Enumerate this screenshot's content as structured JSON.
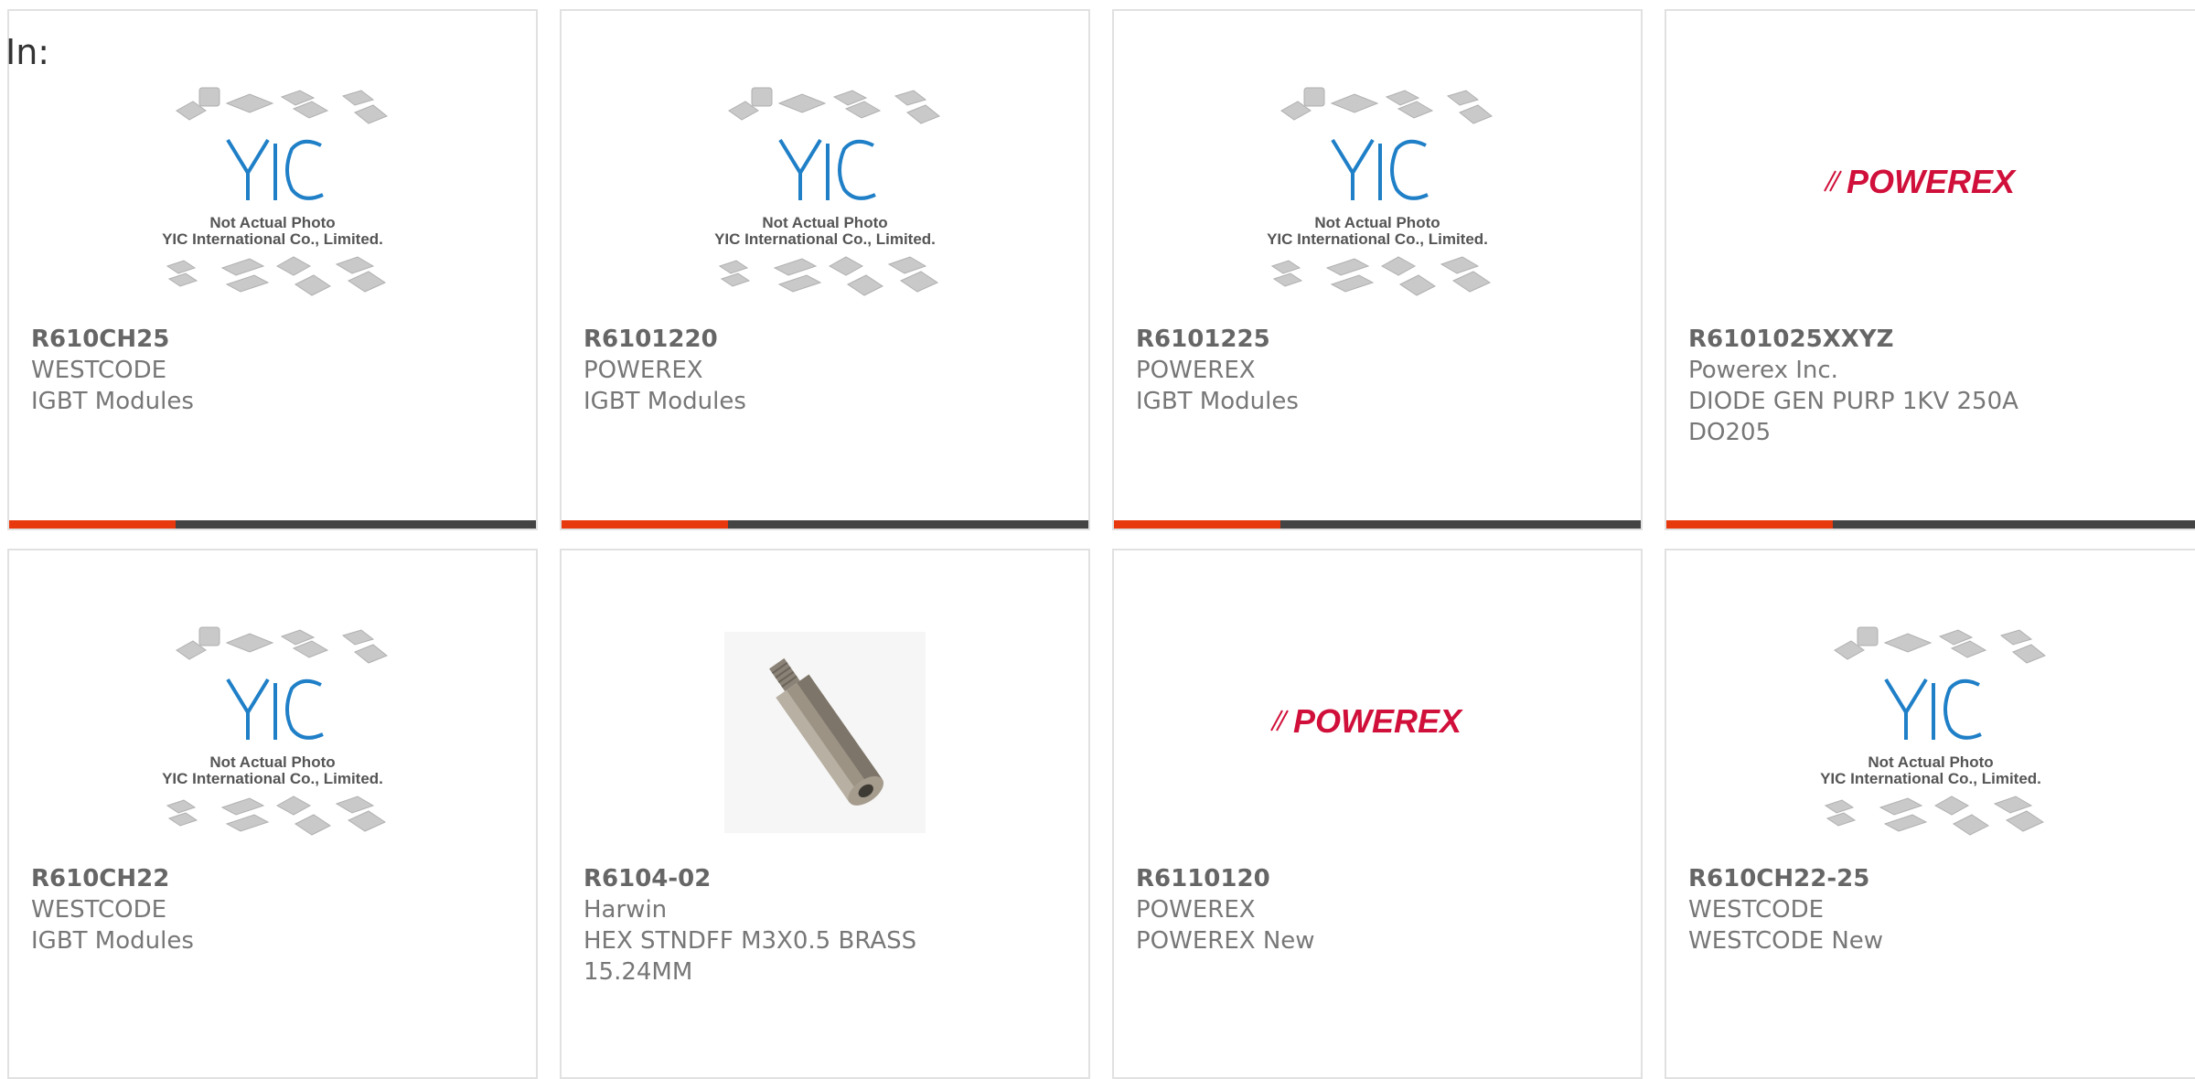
{
  "page": {
    "prefix_label": "In:"
  },
  "colors": {
    "accent": "#e8380d",
    "bar": "#444444",
    "yic_blue": "#1f7fc7",
    "powerex_red": "#d0103a"
  },
  "placeholder_text": {
    "line1": "Not Actual Photo",
    "line2": "YIC International Co., Limited.",
    "logo": "YIC"
  },
  "powerex_logo_text": "POWEREX",
  "products": [
    {
      "part_number": "R610CH25",
      "manufacturer": "WESTCODE",
      "description": "IGBT Modules",
      "image": "yic-placeholder-icon"
    },
    {
      "part_number": "R6101220",
      "manufacturer": "POWEREX",
      "description": "IGBT Modules",
      "image": "yic-placeholder-icon"
    },
    {
      "part_number": "R6101225",
      "manufacturer": "POWEREX",
      "description": "IGBT Modules",
      "image": "yic-placeholder-icon"
    },
    {
      "part_number": "R6101025XXYZ",
      "manufacturer": "Powerex Inc.",
      "description_lines": [
        "DIODE GEN PURP 1KV 250A",
        "DO205"
      ],
      "image": "powerex-logo"
    },
    {
      "part_number": "R610CH22",
      "manufacturer": "WESTCODE",
      "description": "IGBT Modules",
      "image": "yic-placeholder-icon"
    },
    {
      "part_number": "R6104-02",
      "manufacturer": "Harwin",
      "description_lines": [
        "HEX STNDFF M3X0.5 BRASS",
        "15.24MM"
      ],
      "image": "hex-standoff-photo"
    },
    {
      "part_number": "R6110120",
      "manufacturer": "POWEREX",
      "description": "POWEREX New",
      "image": "powerex-logo"
    },
    {
      "part_number": "R610CH22-25",
      "manufacturer": "WESTCODE",
      "description": "WESTCODE New",
      "image": "yic-placeholder-icon"
    }
  ]
}
